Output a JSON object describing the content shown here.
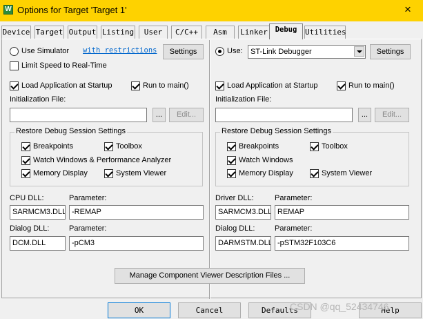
{
  "window": {
    "title": "Options for Target 'Target 1'",
    "icon_letter": "W",
    "close_glyph": "×"
  },
  "tabs": [
    {
      "label": "Device"
    },
    {
      "label": "Target"
    },
    {
      "label": "Output"
    },
    {
      "label": "Listing"
    },
    {
      "label": "User"
    },
    {
      "label": "C/C++"
    },
    {
      "label": "Asm"
    },
    {
      "label": "Linker"
    },
    {
      "label": "Debug",
      "active": true
    },
    {
      "label": "Utilities"
    }
  ],
  "left": {
    "use_simulator": "Use Simulator",
    "restrictions_link": "with restrictions",
    "settings": "Settings",
    "limit_speed": "Limit Speed to Real-Time",
    "load_app": "Load Application at Startup",
    "run_to_main": "Run to main()",
    "init_file_label": "Initialization File:",
    "init_file_value": "",
    "browse": "...",
    "edit": "Edit...",
    "restore_title": "Restore Debug Session Settings",
    "breakpoints": "Breakpoints",
    "toolbox": "Toolbox",
    "watch_windows": "Watch Windows & Performance Analyzer",
    "memory_display": "Memory Display",
    "system_viewer": "System Viewer",
    "dll_label": "CPU DLL:",
    "parameter_label": "Parameter:",
    "dll_value": "SARMCM3.DLL",
    "dll_param": "-REMAP",
    "dialog_dll_label": "Dialog DLL:",
    "dialog_param_label": "Parameter:",
    "dialog_dll_value": "DCM.DLL",
    "dialog_param": "-pCM3"
  },
  "right": {
    "use": "Use:",
    "debugger": "ST-Link Debugger",
    "settings": "Settings",
    "load_app": "Load Application at Startup",
    "run_to_main": "Run to main()",
    "init_file_label": "Initialization File:",
    "init_file_value": "",
    "browse": "...",
    "edit": "Edit...",
    "restore_title": "Restore Debug Session Settings",
    "breakpoints": "Breakpoints",
    "toolbox": "Toolbox",
    "watch_windows": "Watch Windows",
    "memory_display": "Memory Display",
    "system_viewer": "System Viewer",
    "dll_label": "Driver DLL:",
    "parameter_label": "Parameter:",
    "dll_value": "SARMCM3.DLL",
    "dll_param": "REMAP",
    "dialog_dll_label": "Dialog DLL:",
    "dialog_param_label": "Parameter:",
    "dialog_dll_value": "DARMSTM.DLL",
    "dialog_param": "-pSTM32F103C6"
  },
  "manage_button": "Manage Component Viewer Description Files ...",
  "footer": {
    "ok": "OK",
    "cancel": "Cancel",
    "defaults": "Defaults",
    "help": "Help"
  },
  "watermark": "CSDN @qq_52434746"
}
